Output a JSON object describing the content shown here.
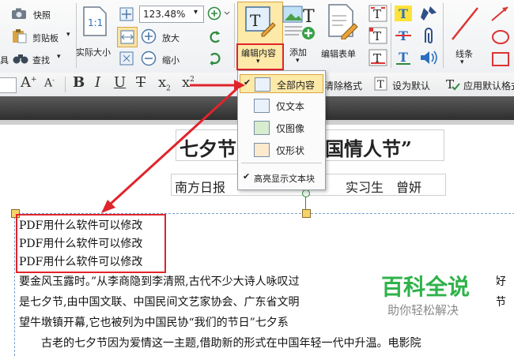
{
  "ribbon": {
    "snapshot_label": "快照",
    "clipboard_label": "剪贴板",
    "find_label": "查找",
    "actual_size_label": "实际大小",
    "zoom_value": "123.48%",
    "zoom_in_label": "放大",
    "zoom_out_label": "缩小",
    "edit_content_label": "编辑内容",
    "add_label": "添加",
    "edit_form_label": "编辑表单",
    "lines_label": "线条",
    "left_cut_text": "具"
  },
  "format_bar": {
    "clear_format_label": "清除格式",
    "set_default_label": "设为默认",
    "apply_default_label": "应用默认格式"
  },
  "edit_menu": {
    "items": [
      {
        "label": "全部内容",
        "icon": "edit-all-icon",
        "selected": true
      },
      {
        "label": "仅文本",
        "icon": "text-only-icon"
      },
      {
        "label": "仅图像",
        "icon": "image-only-icon"
      },
      {
        "label": "仅形状",
        "icon": "shape-only-icon"
      }
    ],
    "highlight_label": "高亮显示文本块"
  },
  "document": {
    "title_left": "七夕节",
    "title_right": "国情人节”",
    "byline_left": "南方日报",
    "byline_right": "实习生　曾妍",
    "inserted_lines": [
      "PDF用什么软件可以修改",
      "PDF用什么软件可以修改",
      "PDF用什么软件可以修改"
    ],
    "body_lines": [
      "要金风玉露时。”从李商隐到李清照,古代不少大诗人咏叹过",
      "是七夕节,由中国文联、中国民间文艺家协会、广东省文明",
      "望牛墩镇开幕,它也被列为中国民协“我们的节日”七夕系",
      "　　古老的七夕节因为爱情这一主题,借助新的形式在中国年轻一代中升温。电影院"
    ],
    "body_right_fragments": [
      "美好",
      "情节"
    ]
  },
  "watermark": {
    "title": "百科全说",
    "subtitle": "助你轻松解决"
  },
  "colors": {
    "annotation_red": "#e0242c",
    "watermark_green": "#2fb24a",
    "menu_highlight": "#fde9a8"
  }
}
